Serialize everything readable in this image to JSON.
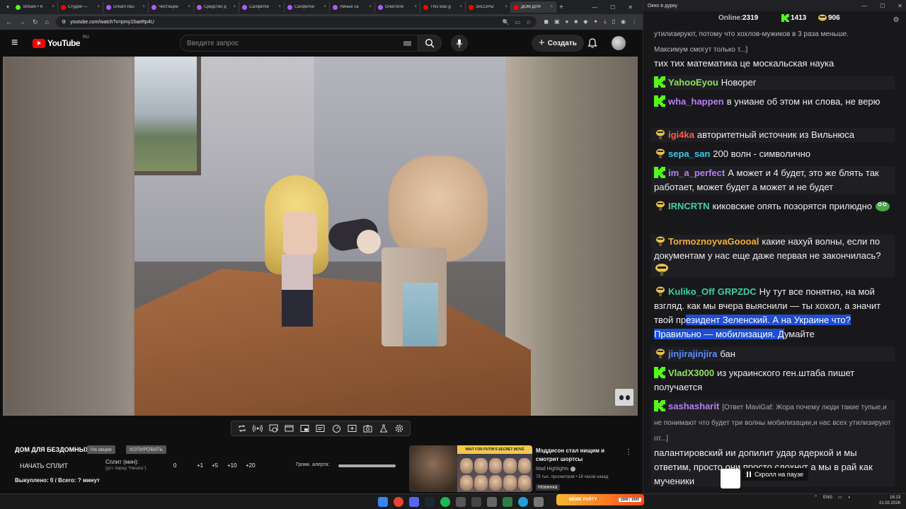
{
  "browser": {
    "tabs": [
      {
        "label": "Stream • K",
        "color": "#53fc18"
      },
      {
        "label": "Студия —",
        "color": "#ff0000"
      },
      {
        "label": "Dream hau",
        "color": "#b15cff"
      },
      {
        "label": "Чистящее",
        "color": "#b15cff"
      },
      {
        "label": "Средство д",
        "color": "#b15cff"
      },
      {
        "label": "Салфетки",
        "color": "#b15cff"
      },
      {
        "label": "Салфетки",
        "color": "#b15cff"
      },
      {
        "label": "Умные са",
        "color": "#b15cff"
      },
      {
        "label": "Очистите",
        "color": "#b15cff"
      },
      {
        "label": "This was g",
        "color": "#ff0000"
      },
      {
        "label": "ЗАСОРЫ",
        "color": "#ff0000"
      },
      {
        "label": "ДОМ ДЛЯ",
        "color": "#ff0000"
      }
    ],
    "url": "youtube.com/watch?v=pmy15aeRp4U"
  },
  "youtube": {
    "logo_text": "YouTube",
    "logo_region": "RU",
    "search_placeholder": "Введите запрос",
    "create_label": "Создать"
  },
  "split": {
    "title": "ДОМ ДЛЯ БЕЗДОМНЫХ",
    "pill_stock": "На акции",
    "pill_copy": "КОПИРОВАТЬ",
    "start_label": "НАЧАТЬ СПЛИТ",
    "minutes_label": "Сплит (мин):",
    "minutes_hint": "(уст. перед \"Начать\")",
    "value": "0",
    "buttons": [
      "+1",
      "+5",
      "+10",
      "+20"
    ],
    "volume_label": "Громк. алерта:",
    "status": "Выкуплено: 0 / Всего: ? минут"
  },
  "recommendation": {
    "banner": "WAIT FOR PUTIN'S SECRET MOVE",
    "title": "Мэддисон стал нищим и смотрит шортсы",
    "channel": "Mad Highlights",
    "meta": "75 тыс. просмотров • 18 часов назад",
    "badge": "Новинка"
  },
  "chat": {
    "window_title": "Окно в дурку",
    "online_label": "Online:",
    "online_value": "2319",
    "kick_count": "1413",
    "emote_count": "906",
    "scroll_paused": "Скролл на паузе",
    "messages": {
      "m0a": "утилизируют, потому что хохлов-мужиков в 3 раза меньше.",
      "m0b": "Максимум смогут только т...]",
      "m0c": "тих тих математика це москальская наука",
      "m1_user": "YahooEyou",
      "m1_text": "Новорег",
      "m2_user": "wha_happen",
      "m2_text": "в униане об этом ни слова, не верю",
      "m3_user": "igi4ka",
      "m3_text": "авторитетный источник из Вильнюса",
      "m4_user": "sepa_san",
      "m4_text": "200 волн - символично",
      "m5_user": "im_a_perfect",
      "m5_text": "А может и 4 будет, это же блять так работает, может будет а может и не будет",
      "m6_user": "IRNCRTN",
      "m6_text": "киковские опять позорятся прилюдно",
      "m7_user": "TormoznoyvaGoooal",
      "m7_text": "какие нахуй волны, если по документам у нас еще даже первая не закончилась?",
      "m8_user": "Kuliko_Off",
      "m8_mention": "GRPZDC",
      "m8_text_a": "Ну тут все понятно, на мой взгляд. как мы вчера выяснили — ты хохол, а значит твой пр",
      "m8_text_hl": "езидент Зеленский. А на Украине что? Правильно — мобилизация. Д",
      "m8_text_b": "умайте",
      "m9_user": "jinjirajinjira",
      "m9_text": "бан",
      "m10_user": "VladX3000",
      "m10_text": "из украинского ген.штаба пишет получается",
      "m11_user": "sashasharit",
      "m11_reply": "[Ответ MaviGaf: Жора почему люди такие тупые,и не понимают что будет три волны мобилизации,и нас всех утилизируют от...]",
      "m11_text": "палантировский ии допилит удар ядеркой и мы ответим, просто они просто сдохнут а мы в рай как мученики"
    }
  },
  "taskbar": {
    "meme_label": "MEME PARTY",
    "meme_value": "1500 / 1500",
    "lang": "ENG",
    "time": "16:13",
    "date": "21.02.2026"
  },
  "colors": {
    "kick_green": "#53fc18",
    "user_green": "#8fe35a",
    "user_purple": "#b57ff0",
    "user_red": "#ff5c4d",
    "user_cyan": "#37c8f0",
    "user_orange": "#f0b030",
    "user_teal": "#3bd1a0",
    "user_blue": "#5c8cff"
  }
}
